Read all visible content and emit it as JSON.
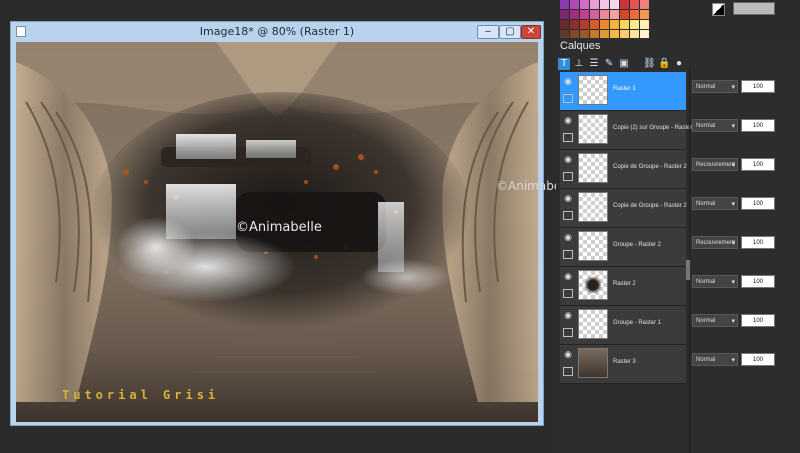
{
  "window": {
    "title": "Image18* @  80% (Raster 1)",
    "buttons": {
      "minimize": "–",
      "maximize": "▢",
      "close": "✕"
    }
  },
  "canvas": {
    "watermark": "©Animabelle",
    "footer_text": "Tutorial Grisi"
  },
  "side_watermark": "©Animabelle",
  "palette": {
    "colors": [
      "#8b3ab0",
      "#b04ab6",
      "#d36cc8",
      "#e7a0d8",
      "#f2c4e6",
      "#f7d7ea",
      "#cc3333",
      "#e05555",
      "#f08080",
      "#7b2b6b",
      "#a0307d",
      "#c04090",
      "#d060a0",
      "#ee8899",
      "#f4a3a3",
      "#d24a2a",
      "#ee6a3a",
      "#f59a50",
      "#6a2a2a",
      "#8c2e2e",
      "#b53b2b",
      "#d65d2b",
      "#eb8a2b",
      "#f5b53b",
      "#f9d55b",
      "#ffe88b",
      "#fff2b3",
      "#5a3a2a",
      "#7a4a2a",
      "#9a5a2a",
      "#c0792a",
      "#e19a3a",
      "#f2b84a",
      "#f8cf6a",
      "#ffe39a",
      "#fff3cf"
    ]
  },
  "layers_panel": {
    "title": "Calques",
    "toolbar_icons": [
      "new-raster-layer-icon",
      "new-vector-layer-icon",
      "new-adjust-layer-icon",
      "new-art-media-icon",
      "new-mask-icon",
      "link-icon",
      "lock-icon",
      "properties-icon"
    ],
    "layers": [
      {
        "name": "Raster 1",
        "blend": "Normal",
        "opacity": "100",
        "selected": true,
        "thumb": "transparent"
      },
      {
        "name": "Copie (2) sur Groupe - Raster 2",
        "blend": "Normal",
        "opacity": "100",
        "selected": false,
        "thumb": "transparent"
      },
      {
        "name": "Copie de Groupe - Raster 2",
        "blend": "Recouvrement",
        "opacity": "100",
        "selected": false,
        "thumb": "transparent"
      },
      {
        "name": "Copie de Groupe - Raster 2",
        "blend": "Normal",
        "opacity": "100",
        "selected": false,
        "thumb": "transparent"
      },
      {
        "name": "Groupe - Raster 2",
        "blend": "Recouvrement",
        "opacity": "100",
        "selected": false,
        "thumb": "transparent"
      },
      {
        "name": "Raster 2",
        "blend": "Normal",
        "opacity": "100",
        "selected": false,
        "thumb": "image"
      },
      {
        "name": "Groupe - Raster 1",
        "blend": "Normal",
        "opacity": "100",
        "selected": false,
        "thumb": "transparent"
      },
      {
        "name": "Raster 3",
        "blend": "Normal",
        "opacity": "100",
        "selected": false,
        "thumb": "solid"
      }
    ]
  }
}
